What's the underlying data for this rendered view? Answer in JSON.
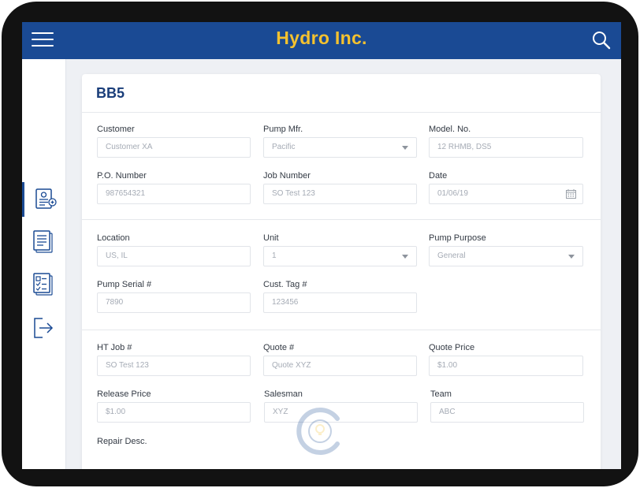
{
  "header": {
    "title": "Hydro Inc.",
    "bg_color": "#1a4a94",
    "title_color": "#f5c22f",
    "menu_icon": "hamburger-menu-icon",
    "search_icon": "search-icon"
  },
  "sidebar": {
    "items": [
      {
        "icon": "new-report-icon",
        "active": true
      },
      {
        "icon": "document-list-icon",
        "active": false
      },
      {
        "icon": "checklist-icon",
        "active": false
      },
      {
        "icon": "logout-icon",
        "active": false
      }
    ]
  },
  "form": {
    "title": "BB5",
    "customer": {
      "label": "Customer",
      "value": "Customer XA"
    },
    "pump_mfr": {
      "label": "Pump Mfr.",
      "value": "Pacific"
    },
    "model_no": {
      "label": "Model. No.",
      "value": "12 RHMB, DS5"
    },
    "po_number": {
      "label": "P.O. Number",
      "value": "987654321"
    },
    "job_number": {
      "label": "Job Number",
      "value": "SO Test 123"
    },
    "date": {
      "label": "Date",
      "value": "01/06/19"
    },
    "location": {
      "label": "Location",
      "value": "US, IL"
    },
    "unit": {
      "label": "Unit",
      "value": "1"
    },
    "pump_purpose": {
      "label": "Pump Purpose",
      "value": "General"
    },
    "pump_serial": {
      "label": "Pump Serial #",
      "value": "7890"
    },
    "cust_tag": {
      "label": "Cust. Tag #",
      "value": "123456"
    },
    "ht_job": {
      "label": "HT Job #",
      "value": "SO Test 123"
    },
    "quote": {
      "label": "Quote #",
      "value": "Quote XYZ"
    },
    "quote_price": {
      "label": "Quote Price",
      "value": "$1.00"
    },
    "release_price": {
      "label": "Release Price",
      "value": "$1.00"
    },
    "salesman": {
      "label": "Salesman",
      "value": "XYZ"
    },
    "team": {
      "label": "Team",
      "value": "ABC"
    },
    "repair_desc": {
      "label": "Repair Desc."
    }
  }
}
